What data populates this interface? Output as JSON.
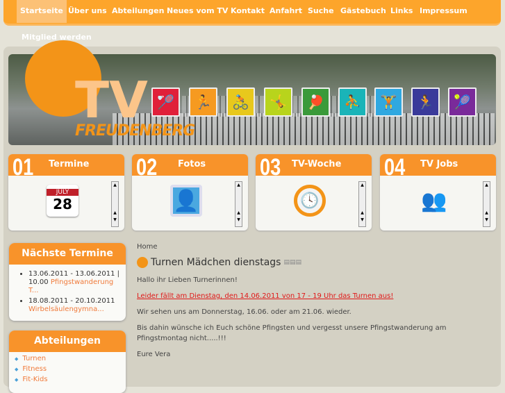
{
  "nav": {
    "items": [
      "Startseite",
      "Über uns",
      "Abteilungen",
      "Neues vom TV",
      "Kontakt",
      "Anfahrt",
      "Suche",
      "Gästebuch",
      "Links",
      "Impressum"
    ],
    "second_row": "Mitglied werden"
  },
  "banner": {
    "logo_text": "TV",
    "logo_subtitle": "FREUDENBERG"
  },
  "boxes": [
    {
      "num": "01",
      "title": "Termine",
      "calendar_month": "JULY",
      "calendar_day": "28"
    },
    {
      "num": "02",
      "title": "Fotos"
    },
    {
      "num": "03",
      "title": "TV-Woche"
    },
    {
      "num": "04",
      "title": "TV Jobs"
    }
  ],
  "sidebar": {
    "termine_title": "Nächste Termine",
    "termine": [
      {
        "dates": "13.06.2011 - 13.06.2011 | 10.00",
        "link": "Pfingstwanderung T..."
      },
      {
        "dates": "18.08.2011 - 20.10.2011",
        "link": "Wirbelsäulengymna..."
      }
    ],
    "abteilungen_title": "Abteilungen",
    "abteilungen": [
      "Turnen",
      "Fitness",
      "Fit-Kids"
    ]
  },
  "content": {
    "breadcrumb": "Home",
    "title": "Turnen Mädchen dienstags",
    "paragraphs": [
      "Hallo ihr Lieben Turnerinnen!",
      "Leider fällt am Dienstag, den 14.06.2011 von 17 - 19 Uhr das Turnen aus!",
      "Wir sehen uns am Donnerstag, 16.06. oder am 21.06. wieder.",
      "Bis dahin wünsche ich Euch schöne Pfingsten und vergesst unsere Pfingstwanderung am Pfingstmontag nicht.....!!!",
      "Eure Vera"
    ]
  },
  "colors": {
    "orange": "#f8932a",
    "nav": "#fda52b",
    "link": "#f07a3a",
    "alert": "#e01818"
  }
}
